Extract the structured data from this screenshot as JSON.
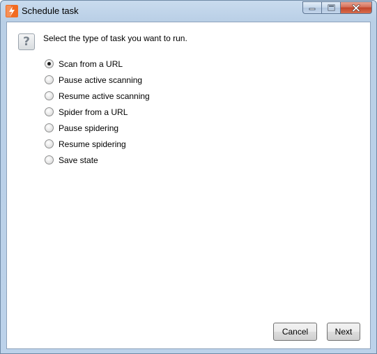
{
  "window": {
    "title": "Schedule task",
    "app_icon": "burp-logo-icon",
    "caption_buttons": {
      "minimize": "minimize-icon",
      "maximize": "maximize-icon",
      "close": "close-icon"
    }
  },
  "content": {
    "help_icon": "question-mark-icon",
    "help_glyph": "?",
    "prompt": "Select the type of task you want to run.",
    "options": [
      {
        "label": "Scan from a URL",
        "selected": true
      },
      {
        "label": "Pause active scanning",
        "selected": false
      },
      {
        "label": "Resume active scanning",
        "selected": false
      },
      {
        "label": "Spider from a URL",
        "selected": false
      },
      {
        "label": "Pause spidering",
        "selected": false
      },
      {
        "label": "Resume spidering",
        "selected": false
      },
      {
        "label": "Save state",
        "selected": false
      }
    ]
  },
  "buttons": {
    "cancel": "Cancel",
    "next": "Next"
  },
  "colors": {
    "frame": "#bcd2ea",
    "close_button": "#c2442a",
    "app_icon_orange": "#f26b21"
  }
}
